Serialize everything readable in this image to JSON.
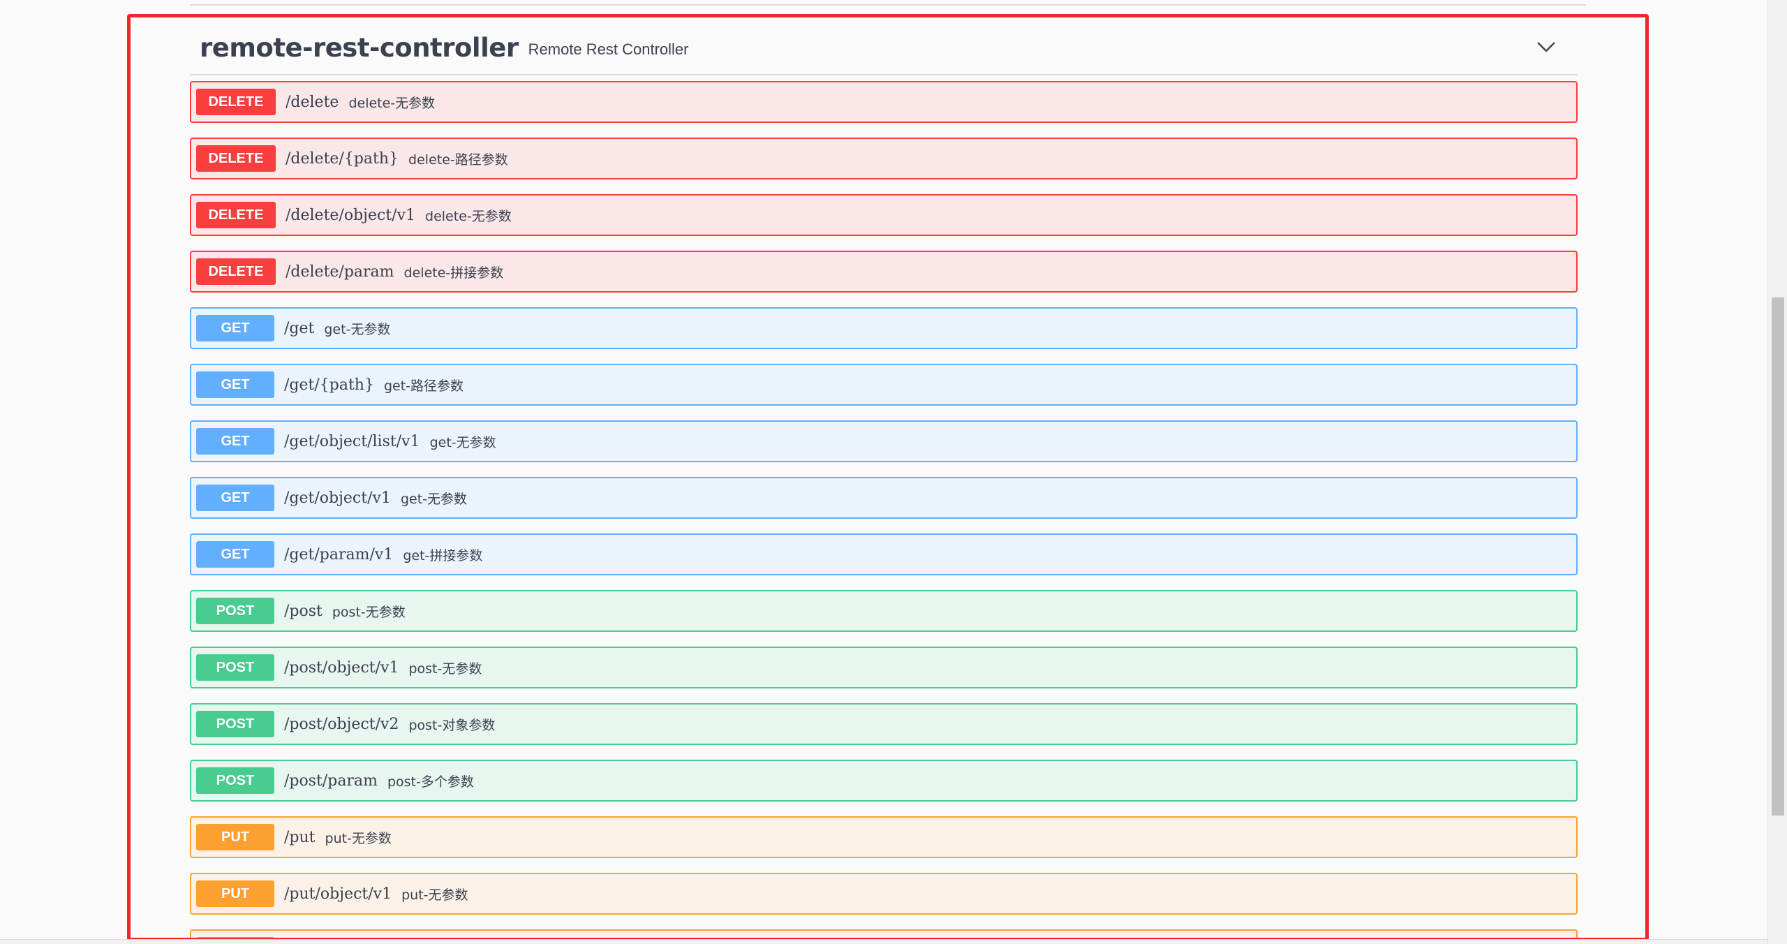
{
  "tag": {
    "name": "remote-rest-controller",
    "description": "Remote Rest Controller"
  },
  "icons": {
    "expand": "chevron-down-icon"
  },
  "colors": {
    "delete": "#f93e3e",
    "get": "#61affe",
    "post": "#49cc90",
    "put": "#fca130",
    "highlight": "#f0262d"
  },
  "operations": [
    {
      "method": "DELETE",
      "path": "/delete",
      "summary": "delete-无参数"
    },
    {
      "method": "DELETE",
      "path": "/delete/{path}",
      "summary": "delete-路径参数"
    },
    {
      "method": "DELETE",
      "path": "/delete/object/v1",
      "summary": "delete-无参数"
    },
    {
      "method": "DELETE",
      "path": "/delete/param",
      "summary": "delete-拼接参数"
    },
    {
      "method": "GET",
      "path": "/get",
      "summary": "get-无参数"
    },
    {
      "method": "GET",
      "path": "/get/{path}",
      "summary": "get-路径参数"
    },
    {
      "method": "GET",
      "path": "/get/object/list/v1",
      "summary": "get-无参数"
    },
    {
      "method": "GET",
      "path": "/get/object/v1",
      "summary": "get-无参数"
    },
    {
      "method": "GET",
      "path": "/get/param/v1",
      "summary": "get-拼接参数"
    },
    {
      "method": "POST",
      "path": "/post",
      "summary": "post-无参数"
    },
    {
      "method": "POST",
      "path": "/post/object/v1",
      "summary": "post-无参数"
    },
    {
      "method": "POST",
      "path": "/post/object/v2",
      "summary": "post-对象参数"
    },
    {
      "method": "POST",
      "path": "/post/param",
      "summary": "post-多个参数"
    },
    {
      "method": "PUT",
      "path": "/put",
      "summary": "put-无参数"
    },
    {
      "method": "PUT",
      "path": "/put/object/v1",
      "summary": "put-无参数"
    },
    {
      "method": "PUT",
      "path": "",
      "summary": ""
    }
  ]
}
